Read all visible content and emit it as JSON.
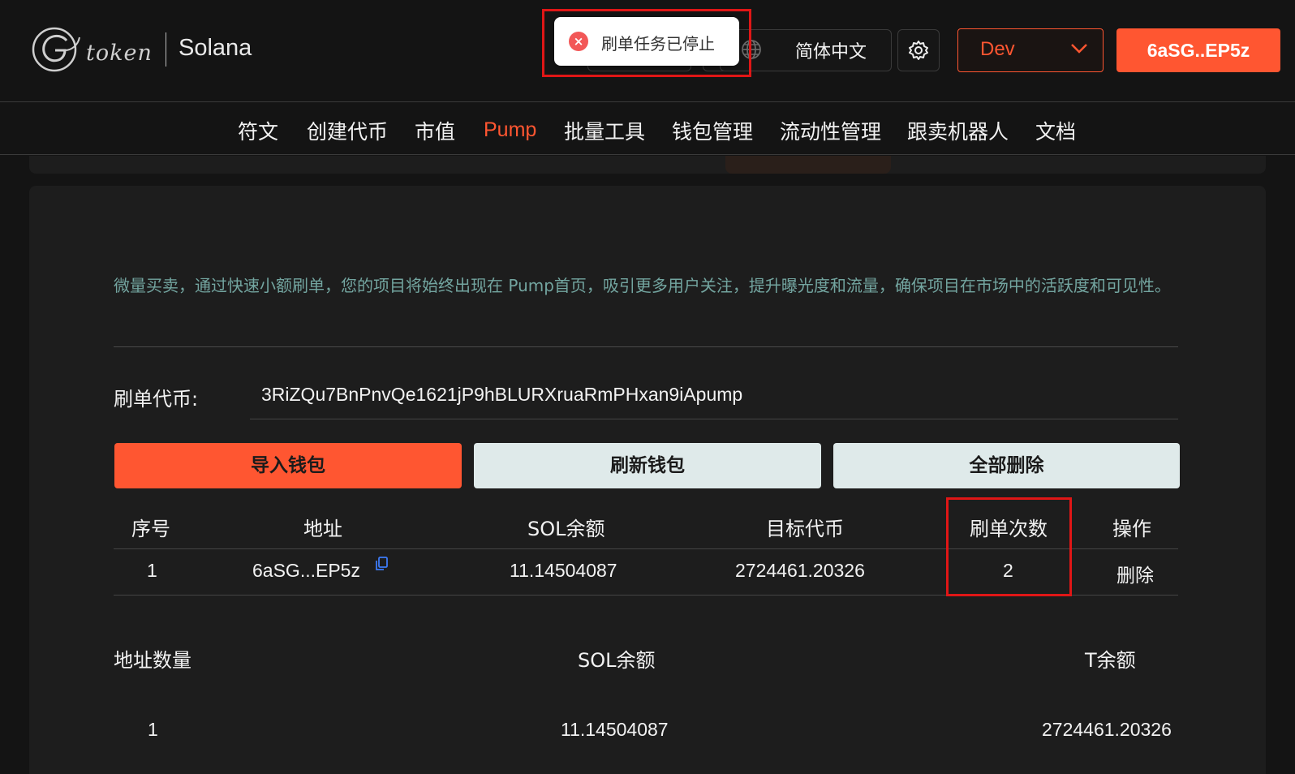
{
  "brand": {
    "logo_text": "token",
    "chain": "Solana"
  },
  "header": {
    "language": "简体中文",
    "network": "Dev",
    "wallet": "6aSG..EP5z",
    "icons": [
      "globe-icon",
      "gear-icon",
      "chevron-down-icon",
      "close-circle-icon",
      "copy-icon"
    ]
  },
  "toast": {
    "message": "刷单任务已停止",
    "icon": "×"
  },
  "nav": [
    "符文",
    "创建代币",
    "市值",
    "Pump",
    "批量工具",
    "钱包管理",
    "流动性管理",
    "跟卖机器人",
    "文档"
  ],
  "nav_active": "Pump",
  "description": "微量买卖，通过快速小额刷单，您的项目将始终出现在 Pump首页，吸引更多用户关注，提升曝光度和流量，确保项目在市场中的活跃度和可见性。",
  "token_field": {
    "label": "刷单代币:",
    "value": "3RiZQu7BnPnvQe1621jP9hBLURXruaRmPHxan9iApump"
  },
  "buttons": {
    "import": "导入钱包",
    "refresh": "刷新钱包",
    "delete_all": "全部删除"
  },
  "table": {
    "headers": [
      "序号",
      "地址",
      "SOL余额",
      "目标代币",
      "刷单次数",
      "操作"
    ],
    "rows": [
      {
        "index": "1",
        "address": "6aSG...EP5z",
        "sol": "11.14504087",
        "target": "2724461.20326",
        "count": "2",
        "action": "删除"
      }
    ]
  },
  "summary": {
    "labels": [
      "地址数量",
      "SOL余额",
      "T余额"
    ],
    "values": [
      "1",
      "11.14504087",
      "2724461.20326"
    ]
  },
  "colors": {
    "accent": "#ff5631",
    "desc_text": "#73a5a0",
    "highlight": "#e01616"
  }
}
